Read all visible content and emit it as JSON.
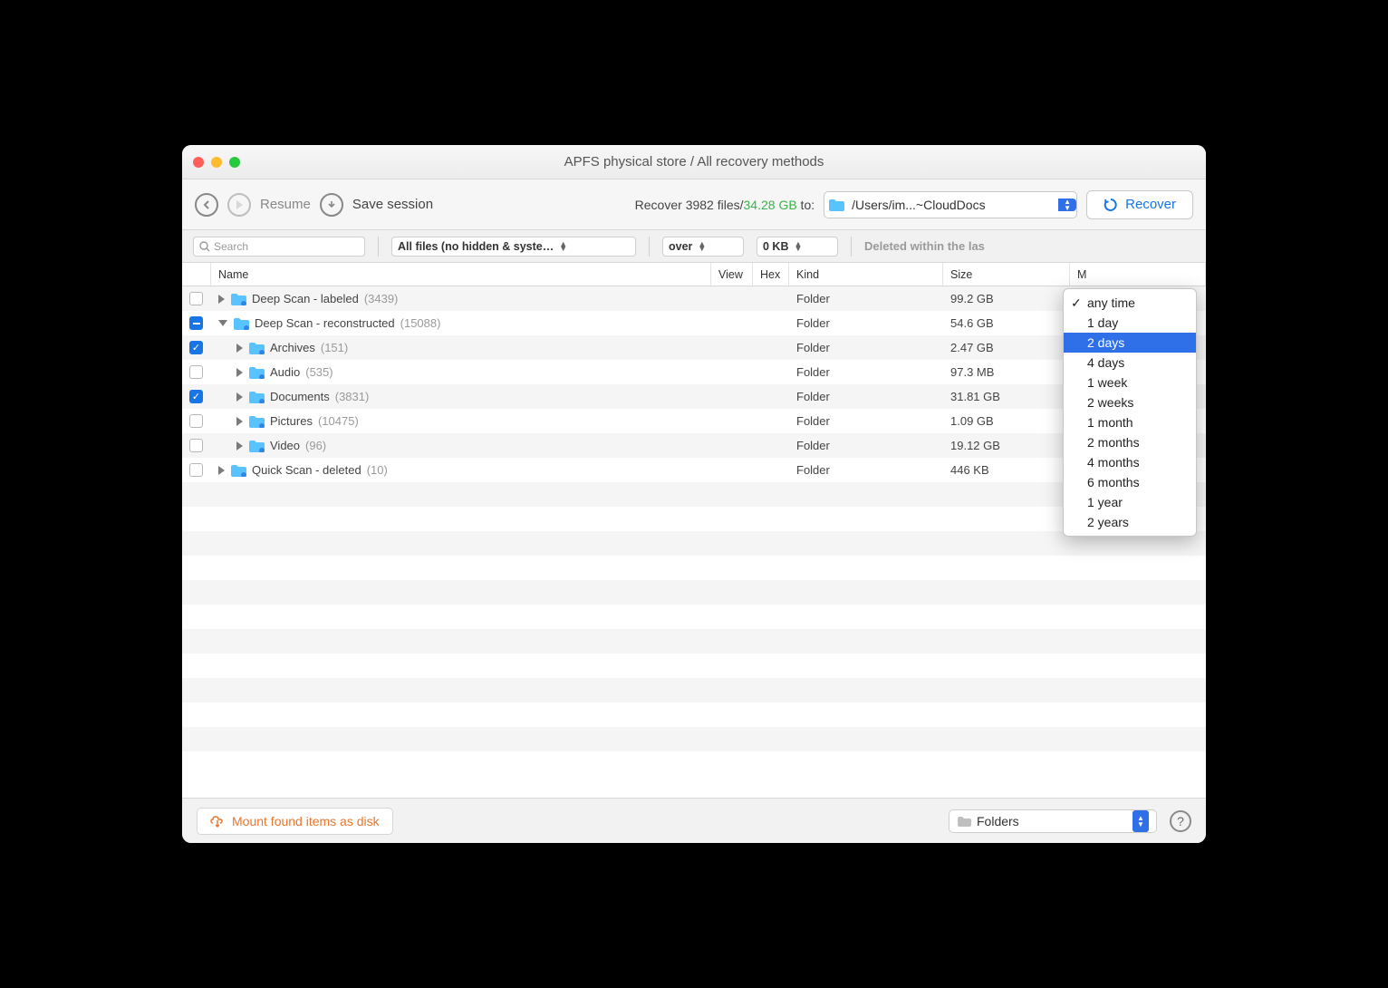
{
  "title": "APFS physical store / All recovery methods",
  "toolbar": {
    "resume_label": "Resume",
    "save_session_label": "Save session",
    "recover_prefix": "Recover ",
    "recover_count": "3982 files/",
    "recover_size": "34.28 GB",
    "recover_suffix": " to:",
    "path": "/Users/im...~CloudDocs",
    "recover_button": "Recover"
  },
  "filters": {
    "search_placeholder": "Search",
    "filter1": "All files (no hidden & syste…",
    "filter2": "over",
    "filter3": "0 KB",
    "deleted_label": "Deleted within the las"
  },
  "columns": {
    "name": "Name",
    "view": "View",
    "hex": "Hex",
    "kind": "Kind",
    "size": "Size",
    "mod": "M"
  },
  "rows": [
    {
      "check": "off",
      "indent": 0,
      "expanded": false,
      "name": "Deep Scan - labeled",
      "count": "(3439)",
      "kind": "Folder",
      "size": "99.2 GB"
    },
    {
      "check": "mixed",
      "indent": 0,
      "expanded": true,
      "name": "Deep Scan - reconstructed",
      "count": "(15088)",
      "kind": "Folder",
      "size": "54.6 GB"
    },
    {
      "check": "checked",
      "indent": 1,
      "expanded": false,
      "name": "Archives",
      "count": "(151)",
      "kind": "Folder",
      "size": "2.47 GB"
    },
    {
      "check": "off",
      "indent": 1,
      "expanded": false,
      "name": "Audio",
      "count": "(535)",
      "kind": "Folder",
      "size": "97.3 MB"
    },
    {
      "check": "checked",
      "indent": 1,
      "expanded": false,
      "name": "Documents",
      "count": "(3831)",
      "kind": "Folder",
      "size": "31.81 GB"
    },
    {
      "check": "off",
      "indent": 1,
      "expanded": false,
      "name": "Pictures",
      "count": "(10475)",
      "kind": "Folder",
      "size": "1.09 GB"
    },
    {
      "check": "off",
      "indent": 1,
      "expanded": false,
      "name": "Video",
      "count": "(96)",
      "kind": "Folder",
      "size": "19.12 GB"
    },
    {
      "check": "off",
      "indent": 0,
      "expanded": false,
      "name": "Quick Scan - deleted",
      "count": "(10)",
      "kind": "Folder",
      "size": "446 KB"
    }
  ],
  "menu": {
    "items": [
      "any time",
      "1 day",
      "2 days",
      "4 days",
      "1 week",
      "2 weeks",
      "1 month",
      "2 months",
      "4 months",
      "6 months",
      "1 year",
      "2 years"
    ],
    "current": "any time",
    "highlighted": "2 days"
  },
  "bottom": {
    "mount_label": "Mount found items as disk",
    "view_mode": "Folders"
  }
}
